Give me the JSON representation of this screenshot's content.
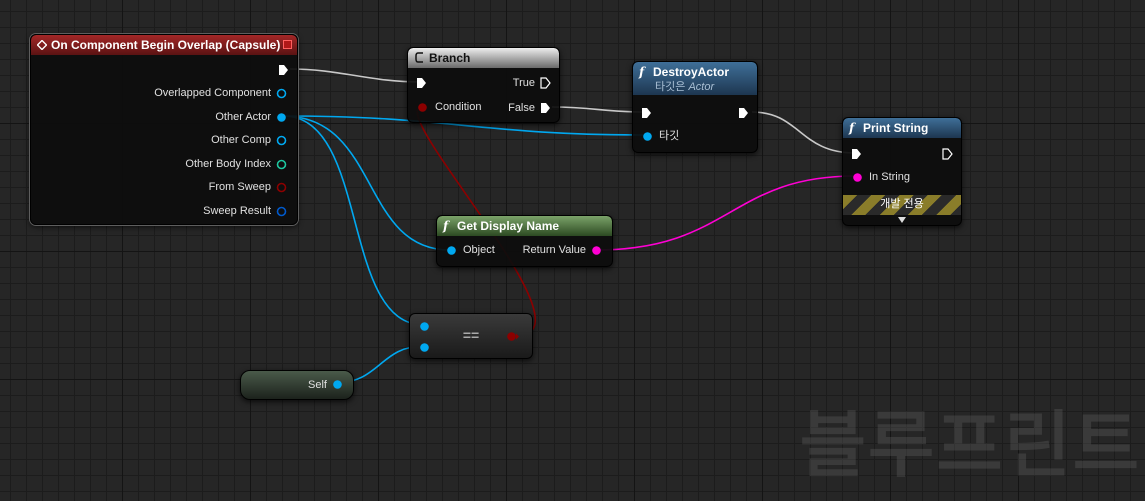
{
  "nodes": {
    "begin_overlap": {
      "title": "On Component Begin Overlap (Capsule)",
      "pins": [
        "Overlapped Component",
        "Other Actor",
        "Other Comp",
        "Other Body Index",
        "From Sweep",
        "Sweep Result"
      ]
    },
    "branch": {
      "title": "Branch",
      "condition": "Condition",
      "true_label": "True",
      "false_label": "False"
    },
    "destroy_actor": {
      "title": "DestroyActor",
      "subtitle_prefix": "타깃은",
      "subtitle_class": "Actor",
      "target": "타깃"
    },
    "print_string": {
      "title": "Print String",
      "in_string": "In String",
      "dev_only": "개발 전용"
    },
    "get_display_name": {
      "title": "Get Display Name",
      "object": "Object",
      "return_value": "Return Value"
    },
    "equals": {
      "title": "=="
    },
    "self": {
      "label": "Self"
    }
  },
  "watermark": "블루프린트",
  "colors": {
    "event_header": "#a32727",
    "function_header": "#3f6f98",
    "pure_header": "#7ba369",
    "object_pin": "#00a8f0",
    "bool_pin": "#8c0000",
    "string_pin": "#ff00d4",
    "int_pin": "#1ec7a0",
    "struct_pin": "#0059cb",
    "exec_wire": "#c8c8c8"
  }
}
